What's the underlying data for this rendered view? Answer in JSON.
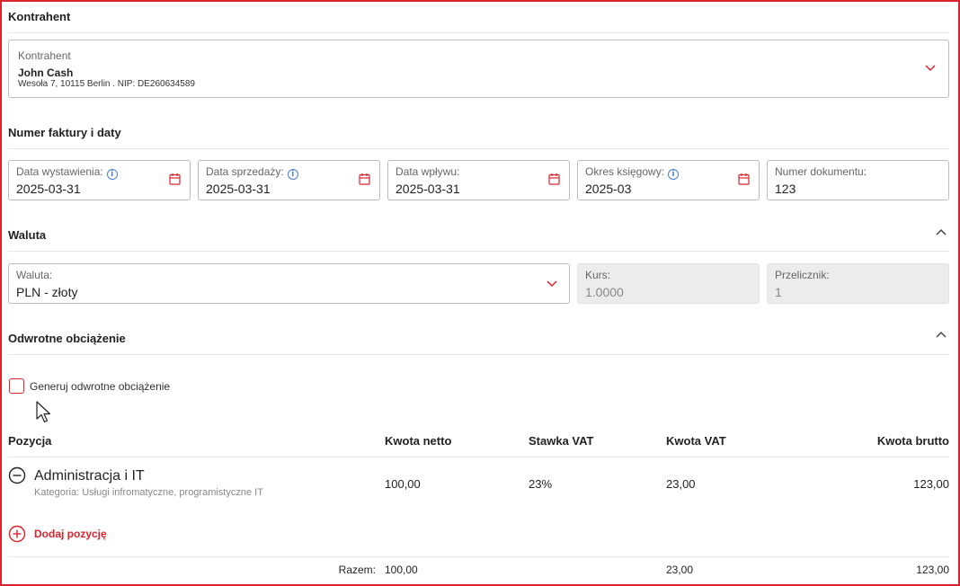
{
  "contractor": {
    "section_title": "Kontrahent",
    "field_label": "Kontrahent",
    "name": "John Cash",
    "address": "Wesoła 7, 10115 Berlin . NIP: DE260634589"
  },
  "invoice": {
    "section_title": "Numer faktury i daty",
    "fields": [
      {
        "label": "Data wystawienia:",
        "value": "2025-03-31"
      },
      {
        "label": "Data sprzedaży:",
        "value": "2025-03-31"
      },
      {
        "label": "Data wpływu:",
        "value": "2025-03-31"
      },
      {
        "label": "Okres księgowy:",
        "value": "2025-03"
      },
      {
        "label": "Numer dokumentu:",
        "value": "123"
      }
    ]
  },
  "currency": {
    "section_title": "Waluta",
    "currency_label": "Waluta:",
    "currency_value": "PLN - złoty",
    "rate_label": "Kurs:",
    "rate_value": "1.0000",
    "multiplier_label": "Przelicznik:",
    "multiplier_value": "1"
  },
  "reverse_charge": {
    "section_title": "Odwrotne obciążenie",
    "checkbox_label": "Generuj odwrotne obciążenie",
    "checked": false
  },
  "positions": {
    "headers": {
      "position": "Pozycja",
      "net": "Kwota netto",
      "vat_rate": "Stawka VAT",
      "vat": "Kwota VAT",
      "gross": "Kwota brutto"
    },
    "rows": [
      {
        "name": "Administracja i IT",
        "category": "Kategoria: Usługi infromatyczne, programistyczne IT",
        "net": "100,00",
        "vat_rate": "23%",
        "vat": "23,00",
        "gross": "123,00"
      }
    ],
    "add_label": "Dodaj pozycję",
    "total_label": "Razem:",
    "total_net": "100,00",
    "total_vat": "23,00",
    "total_gross": "123,00"
  },
  "colors": {
    "accent": "#d9232d",
    "info": "#4a7fd4"
  }
}
